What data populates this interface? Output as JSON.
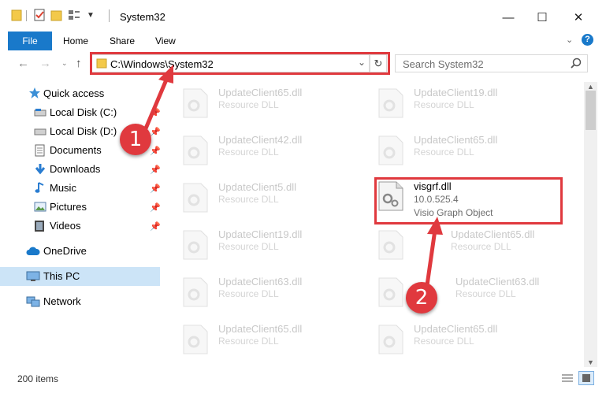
{
  "window": {
    "title": "System32"
  },
  "ribbon": {
    "file": "File",
    "home": "Home",
    "share": "Share",
    "view": "View"
  },
  "address": {
    "path": "C:\\Windows\\System32"
  },
  "search": {
    "placeholder": "Search System32"
  },
  "sidebar": {
    "quick_access": "Quick access",
    "items": [
      {
        "label": "Local Disk (C:)"
      },
      {
        "label": "Local Disk (D:)"
      },
      {
        "label": "Documents"
      },
      {
        "label": "Downloads"
      },
      {
        "label": "Music"
      },
      {
        "label": "Pictures"
      },
      {
        "label": "Videos"
      }
    ],
    "onedrive": "OneDrive",
    "this_pc": "This PC",
    "network": "Network"
  },
  "files": {
    "left": [
      {
        "name": "UpdateClient65.dll",
        "type": "Resource DLL"
      },
      {
        "name": "UpdateClient42.dll",
        "type": "Resource DLL"
      },
      {
        "name": "UpdateClient5.dll",
        "type": "Resource DLL"
      },
      {
        "name": "UpdateClient19.dll",
        "type": "Resource DLL"
      },
      {
        "name": "UpdateClient63.dll",
        "type": "Resource DLL"
      },
      {
        "name": "UpdateClient65.dll",
        "type": "Resource DLL"
      }
    ],
    "right": [
      {
        "name": "UpdateClient19.dll",
        "type": "Resource DLL"
      },
      {
        "name": "UpdateClient65.dll",
        "type": "Resource DLL"
      },
      {
        "name": "UpdateClient65.dll",
        "type": "Resource DLL"
      },
      {
        "name": "UpdateClient63.dll",
        "type": "Resource DLL"
      },
      {
        "name": "UpdateClient65.dll",
        "type": "Resource DLL"
      }
    ],
    "highlight": {
      "name": "visgrf.dll",
      "version": "10.0.525.4",
      "type": "Visio Graph Object"
    }
  },
  "status": {
    "count": "200 items"
  },
  "annotations": {
    "one": "1",
    "two": "2",
    "color": "#e0393e"
  }
}
